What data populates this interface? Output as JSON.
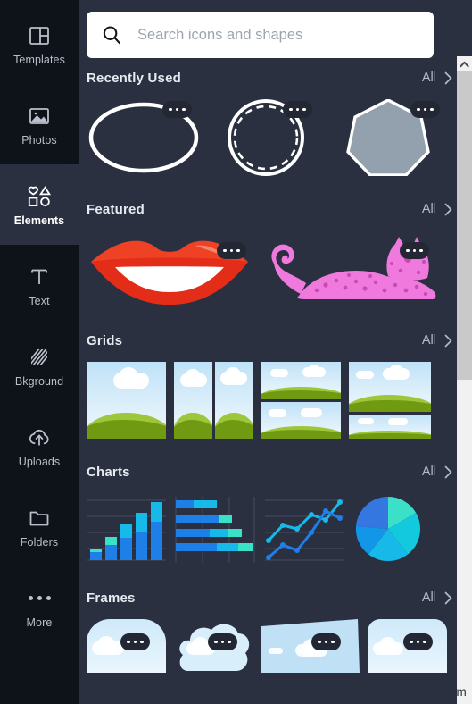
{
  "sidebar": {
    "items": [
      {
        "label": "Templates",
        "icon": "templates-icon",
        "active": false
      },
      {
        "label": "Photos",
        "icon": "photos-icon",
        "active": false
      },
      {
        "label": "Elements",
        "icon": "elements-icon",
        "active": true
      },
      {
        "label": "Text",
        "icon": "text-icon",
        "active": false
      },
      {
        "label": "Bkground",
        "icon": "background-icon",
        "active": false
      },
      {
        "label": "Uploads",
        "icon": "uploads-icon",
        "active": false
      },
      {
        "label": "Folders",
        "icon": "folders-icon",
        "active": false
      },
      {
        "label": "More",
        "icon": "more-dots-icon",
        "active": false
      }
    ]
  },
  "search": {
    "placeholder": "Search icons and shapes",
    "value": "",
    "icon": "search-icon"
  },
  "sections": [
    {
      "title": "Recently Used",
      "all_label": "All",
      "items": [
        {
          "name": "ellipse-outline-shape",
          "badge": "more-options-icon"
        },
        {
          "name": "dashed-circle-shape",
          "badge": "more-options-icon"
        },
        {
          "name": "filled-heptagon-shape",
          "badge": "more-options-icon"
        }
      ]
    },
    {
      "title": "Featured",
      "all_label": "All",
      "items": [
        {
          "name": "red-lips-illustration",
          "badge": "more-options-icon"
        },
        {
          "name": "pink-leopard-illustration",
          "badge": "more-options-icon"
        }
      ]
    },
    {
      "title": "Grids",
      "all_label": "All",
      "items": [
        {
          "name": "grid-layout-single"
        },
        {
          "name": "grid-layout-two-columns"
        },
        {
          "name": "grid-layout-two-rows"
        },
        {
          "name": "grid-layout-stacked"
        }
      ]
    },
    {
      "title": "Charts",
      "all_label": "All",
      "items": [
        {
          "name": "stacked-bar-chart-thumb"
        },
        {
          "name": "horizontal-bar-chart-thumb"
        },
        {
          "name": "line-chart-thumb"
        },
        {
          "name": "pie-chart-thumb"
        }
      ]
    },
    {
      "title": "Frames",
      "all_label": "All",
      "items": [
        {
          "name": "frame-rounded-square",
          "badge": "more-options-icon"
        },
        {
          "name": "frame-cloud-blob",
          "badge": "more-options-icon"
        },
        {
          "name": "frame-skewed-rectangle",
          "badge": "more-options-icon"
        },
        {
          "name": "frame-rounded-rectangle",
          "badge": "more-options-icon"
        }
      ]
    }
  ],
  "scrollbar": {
    "up_arrow": "chevron-up-icon"
  },
  "watermark": "wsxdn.com",
  "colors": {
    "sidebar_bg": "#0e1219",
    "panel_bg": "#2a3040",
    "active_item_bg": "#2a3040",
    "label": "#b9bfcb",
    "title": "#e7eaf0",
    "search_bg": "#ffffff",
    "chart_blue": "#1f7fe8",
    "chart_cyan": "#16b9e8",
    "chart_teal": "#3be0c8",
    "lips_red": "#ef4123",
    "leopard_pink": "#ef79dd",
    "grid_green_back": "#9ec63b",
    "grid_green_front": "#6f9a12",
    "grid_sky": "#bfe2f7",
    "scrollbar_track": "#f1f1f1",
    "scrollbar_thumb": "#c9c9c9"
  }
}
